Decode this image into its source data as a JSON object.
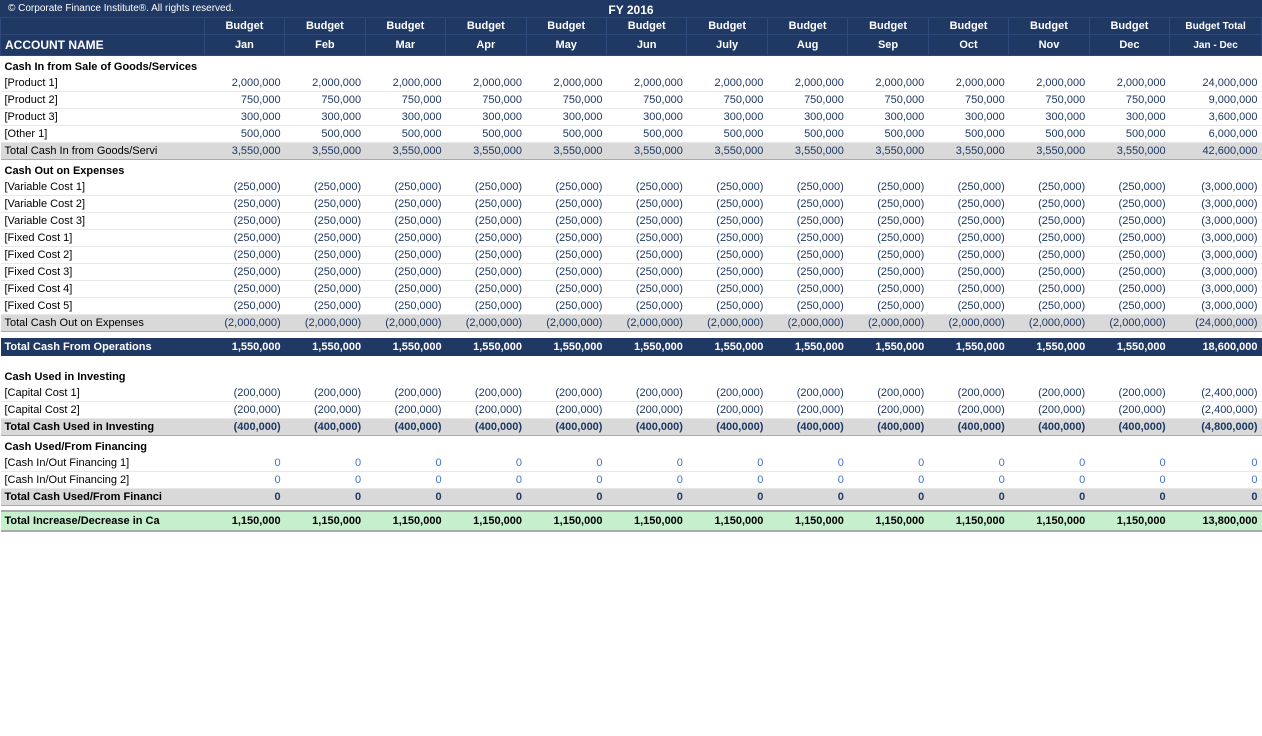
{
  "header": {
    "copyright": "© Corporate Finance Institute®. All rights reserved.",
    "fy": "FY 2016"
  },
  "columns": {
    "account": "ACCOUNT NAME",
    "months": [
      "Jan",
      "Feb",
      "Mar",
      "Apr",
      "May",
      "Jun",
      "July",
      "Aug",
      "Sep",
      "Oct",
      "Nov",
      "Dec"
    ],
    "budget_label": "Budget",
    "total_label": "Budget Total",
    "total_sublabel": "Jan - Dec"
  },
  "sections": [
    {
      "id": "cash-in",
      "title": "Cash In from Sale of Goods/Services",
      "rows": [
        {
          "name": "[Product 1]",
          "values": [
            "2,000,000",
            "2,000,000",
            "2,000,000",
            "2,000,000",
            "2,000,000",
            "2,000,000",
            "2,000,000",
            "2,000,000",
            "2,000,000",
            "2,000,000",
            "2,000,000",
            "2,000,000"
          ],
          "total": "24,000,000",
          "negative": false
        },
        {
          "name": "[Product 2]",
          "values": [
            "750,000",
            "750,000",
            "750,000",
            "750,000",
            "750,000",
            "750,000",
            "750,000",
            "750,000",
            "750,000",
            "750,000",
            "750,000",
            "750,000"
          ],
          "total": "9,000,000",
          "negative": false
        },
        {
          "name": "[Product 3]",
          "values": [
            "300,000",
            "300,000",
            "300,000",
            "300,000",
            "300,000",
            "300,000",
            "300,000",
            "300,000",
            "300,000",
            "300,000",
            "300,000",
            "300,000"
          ],
          "total": "3,600,000",
          "negative": false
        },
        {
          "name": "[Other 1]",
          "values": [
            "500,000",
            "500,000",
            "500,000",
            "500,000",
            "500,000",
            "500,000",
            "500,000",
            "500,000",
            "500,000",
            "500,000",
            "500,000",
            "500,000"
          ],
          "total": "6,000,000",
          "negative": false
        }
      ],
      "subtotal": {
        "label": "Total Cash In from Goods/Servi",
        "values": [
          "3,550,000",
          "3,550,000",
          "3,550,000",
          "3,550,000",
          "3,550,000",
          "3,550,000",
          "3,550,000",
          "3,550,000",
          "3,550,000",
          "3,550,000",
          "3,550,000",
          "3,550,000"
        ],
        "total": "42,600,000"
      }
    },
    {
      "id": "cash-out",
      "title": "Cash Out on Expenses",
      "rows": [
        {
          "name": "[Variable Cost 1]",
          "values": [
            "(250,000)",
            "(250,000)",
            "(250,000)",
            "(250,000)",
            "(250,000)",
            "(250,000)",
            "(250,000)",
            "(250,000)",
            "(250,000)",
            "(250,000)",
            "(250,000)",
            "(250,000)"
          ],
          "total": "(3,000,000)",
          "negative": true
        },
        {
          "name": "[Variable Cost 2]",
          "values": [
            "(250,000)",
            "(250,000)",
            "(250,000)",
            "(250,000)",
            "(250,000)",
            "(250,000)",
            "(250,000)",
            "(250,000)",
            "(250,000)",
            "(250,000)",
            "(250,000)",
            "(250,000)"
          ],
          "total": "(3,000,000)",
          "negative": true
        },
        {
          "name": "[Variable Cost 3]",
          "values": [
            "(250,000)",
            "(250,000)",
            "(250,000)",
            "(250,000)",
            "(250,000)",
            "(250,000)",
            "(250,000)",
            "(250,000)",
            "(250,000)",
            "(250,000)",
            "(250,000)",
            "(250,000)"
          ],
          "total": "(3,000,000)",
          "negative": true
        },
        {
          "name": "[Fixed Cost 1]",
          "values": [
            "(250,000)",
            "(250,000)",
            "(250,000)",
            "(250,000)",
            "(250,000)",
            "(250,000)",
            "(250,000)",
            "(250,000)",
            "(250,000)",
            "(250,000)",
            "(250,000)",
            "(250,000)"
          ],
          "total": "(3,000,000)",
          "negative": true
        },
        {
          "name": "[Fixed Cost 2]",
          "values": [
            "(250,000)",
            "(250,000)",
            "(250,000)",
            "(250,000)",
            "(250,000)",
            "(250,000)",
            "(250,000)",
            "(250,000)",
            "(250,000)",
            "(250,000)",
            "(250,000)",
            "(250,000)"
          ],
          "total": "(3,000,000)",
          "negative": true
        },
        {
          "name": "[Fixed Cost 3]",
          "values": [
            "(250,000)",
            "(250,000)",
            "(250,000)",
            "(250,000)",
            "(250,000)",
            "(250,000)",
            "(250,000)",
            "(250,000)",
            "(250,000)",
            "(250,000)",
            "(250,000)",
            "(250,000)"
          ],
          "total": "(3,000,000)",
          "negative": true
        },
        {
          "name": "[Fixed Cost 4]",
          "values": [
            "(250,000)",
            "(250,000)",
            "(250,000)",
            "(250,000)",
            "(250,000)",
            "(250,000)",
            "(250,000)",
            "(250,000)",
            "(250,000)",
            "(250,000)",
            "(250,000)",
            "(250,000)"
          ],
          "total": "(3,000,000)",
          "negative": true
        },
        {
          "name": "[Fixed Cost 5]",
          "values": [
            "(250,000)",
            "(250,000)",
            "(250,000)",
            "(250,000)",
            "(250,000)",
            "(250,000)",
            "(250,000)",
            "(250,000)",
            "(250,000)",
            "(250,000)",
            "(250,000)",
            "(250,000)"
          ],
          "total": "(3,000,000)",
          "negative": true
        }
      ],
      "subtotal": {
        "label": "Total Cash Out on Expenses",
        "values": [
          "(2,000,000)",
          "(2,000,000)",
          "(2,000,000)",
          "(2,000,000)",
          "(2,000,000)",
          "(2,000,000)",
          "(2,000,000)",
          "(2,000,000)",
          "(2,000,000)",
          "(2,000,000)",
          "(2,000,000)",
          "(2,000,000)"
        ],
        "total": "(24,000,000)"
      }
    },
    {
      "id": "operations-total",
      "type": "total",
      "label": "Total Cash From Operations",
      "values": [
        "1,550,000",
        "1,550,000",
        "1,550,000",
        "1,550,000",
        "1,550,000",
        "1,550,000",
        "1,550,000",
        "1,550,000",
        "1,550,000",
        "1,550,000",
        "1,550,000",
        "1,550,000"
      ],
      "total": "18,600,000"
    },
    {
      "id": "investing",
      "title": "Cash Used in Investing",
      "rows": [
        {
          "name": "[Capital Cost 1]",
          "values": [
            "(200,000)",
            "(200,000)",
            "(200,000)",
            "(200,000)",
            "(200,000)",
            "(200,000)",
            "(200,000)",
            "(200,000)",
            "(200,000)",
            "(200,000)",
            "(200,000)",
            "(200,000)"
          ],
          "total": "(2,400,000)",
          "negative": true
        },
        {
          "name": "[Capital Cost 2]",
          "values": [
            "(200,000)",
            "(200,000)",
            "(200,000)",
            "(200,000)",
            "(200,000)",
            "(200,000)",
            "(200,000)",
            "(200,000)",
            "(200,000)",
            "(200,000)",
            "(200,000)",
            "(200,000)"
          ],
          "total": "(2,400,000)",
          "negative": true
        }
      ],
      "subtotal": {
        "label": "Total Cash Used in Investing",
        "values": [
          "(400,000)",
          "(400,000)",
          "(400,000)",
          "(400,000)",
          "(400,000)",
          "(400,000)",
          "(400,000)",
          "(400,000)",
          "(400,000)",
          "(400,000)",
          "(400,000)",
          "(400,000)"
        ],
        "total": "(4,800,000)",
        "bold": true
      }
    },
    {
      "id": "financing",
      "title": "Cash Used/From Financing",
      "rows": [
        {
          "name": "[Cash In/Out Financing 1]",
          "values": [
            "0",
            "0",
            "0",
            "0",
            "0",
            "0",
            "0",
            "0",
            "0",
            "0",
            "0",
            "0"
          ],
          "total": "0",
          "negative": false,
          "zero_blue": true
        },
        {
          "name": "[Cash In/Out Financing 2]",
          "values": [
            "0",
            "0",
            "0",
            "0",
            "0",
            "0",
            "0",
            "0",
            "0",
            "0",
            "0",
            "0"
          ],
          "total": "0",
          "negative": false,
          "zero_blue": true
        }
      ],
      "subtotal": {
        "label": "Total Cash Used/From Financi",
        "values": [
          "0",
          "0",
          "0",
          "0",
          "0",
          "0",
          "0",
          "0",
          "0",
          "0",
          "0",
          "0"
        ],
        "total": "0",
        "bold": true
      }
    },
    {
      "id": "grand-total",
      "type": "grand-total",
      "label": "Total Increase/Decrease in Ca",
      "values": [
        "1,150,000",
        "1,150,000",
        "1,150,000",
        "1,150,000",
        "1,150,000",
        "1,150,000",
        "1,150,000",
        "1,150,000",
        "1,150,000",
        "1,150,000",
        "1,150,000",
        "1,150,000"
      ],
      "total": "13,800,000"
    }
  ]
}
